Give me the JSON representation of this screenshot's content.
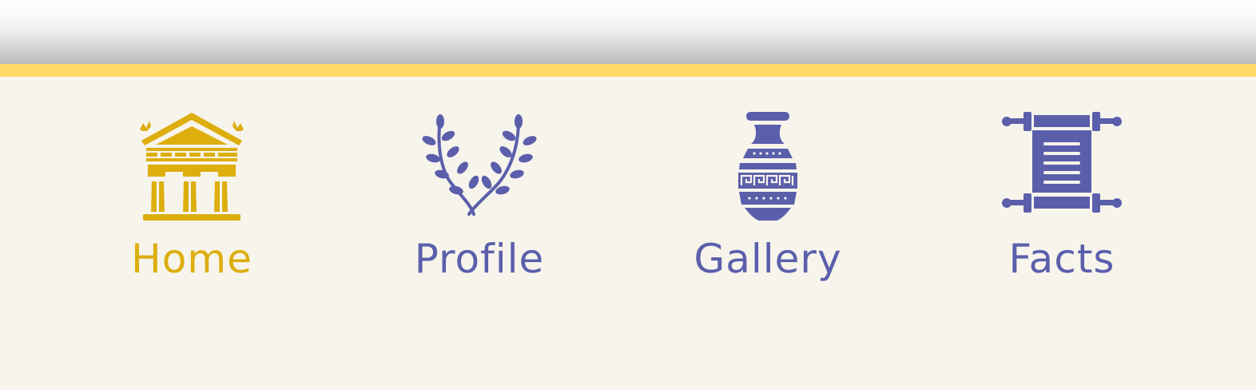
{
  "colors": {
    "accent_stripe": "#ffd966",
    "active": "#dcae0e",
    "inactive": "#5b5fab",
    "background": "#f7f4ec"
  },
  "nav": {
    "items": [
      {
        "label": "Home",
        "icon": "greek-temple-icon",
        "active": true
      },
      {
        "label": "Profile",
        "icon": "laurel-wreath-icon",
        "active": false
      },
      {
        "label": "Gallery",
        "icon": "greek-vase-icon",
        "active": false
      },
      {
        "label": "Facts",
        "icon": "scroll-icon",
        "active": false
      }
    ]
  }
}
